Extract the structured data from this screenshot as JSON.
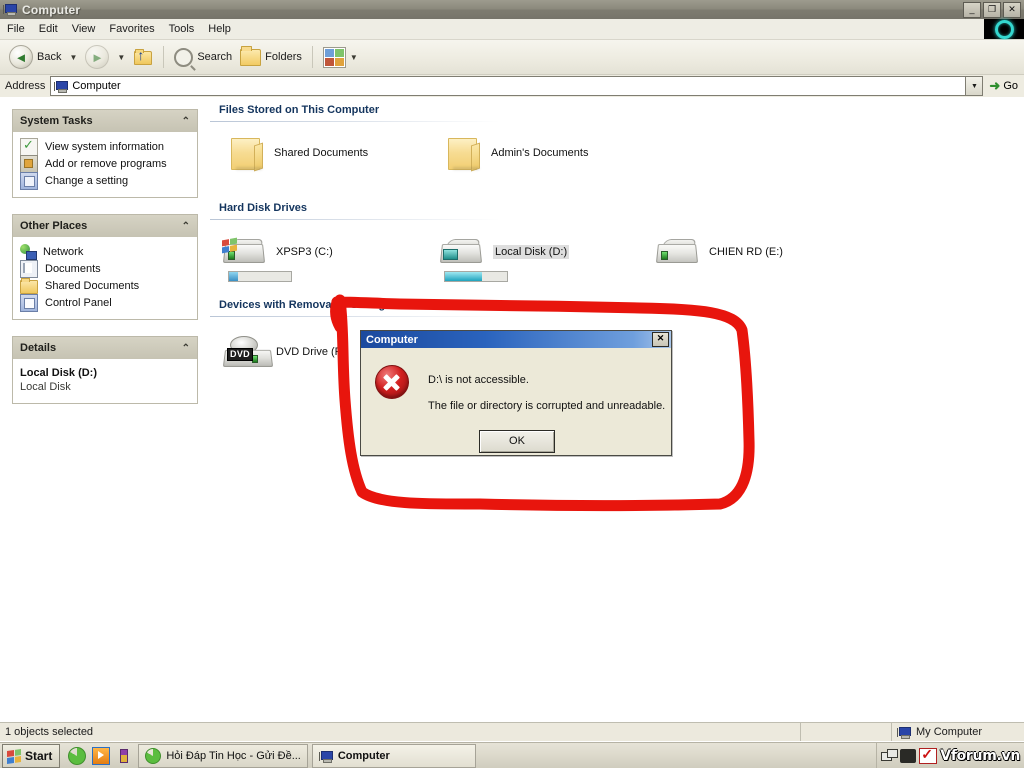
{
  "window": {
    "title": "Computer",
    "title_icon": "my-computer-icon",
    "buttons": {
      "minimize": "_",
      "maximize": "❐",
      "close": "✕"
    }
  },
  "menu": {
    "items": [
      "File",
      "Edit",
      "View",
      "Favorites",
      "Tools",
      "Help"
    ],
    "logo_icon": "teal-ring-logo"
  },
  "toolbar": {
    "back_label": "Back",
    "back_icon": "back-arrow-icon",
    "forward_icon": "forward-arrow-icon",
    "up_icon": "up-folder-icon",
    "search_label": "Search",
    "search_icon": "magnifier-icon",
    "folders_label": "Folders",
    "folders_icon": "folder-icon",
    "views_icon": "views-grid-icon",
    "caret": "▼"
  },
  "address": {
    "label": "Address",
    "value": "Computer",
    "icon": "my-computer-icon",
    "dropdown_caret": "▼",
    "go_label": "Go",
    "go_icon": "green-arrow-icon"
  },
  "sidebar": {
    "panels": [
      {
        "title": "System Tasks",
        "collapse_icon": "chevron-up-icon",
        "items": [
          {
            "label": "View system information",
            "icon": "system-info-icon"
          },
          {
            "label": "Add or remove programs",
            "icon": "add-remove-programs-icon"
          },
          {
            "label": "Change a setting",
            "icon": "control-panel-icon"
          }
        ]
      },
      {
        "title": "Other Places",
        "collapse_icon": "chevron-up-icon",
        "items": [
          {
            "label": "Network",
            "icon": "network-icon"
          },
          {
            "label": "Documents",
            "icon": "documents-icon"
          },
          {
            "label": "Shared Documents",
            "icon": "folder-icon"
          },
          {
            "label": "Control Panel",
            "icon": "control-panel-icon"
          }
        ]
      }
    ],
    "details": {
      "title": "Details",
      "collapse_icon": "chevron-up-icon",
      "name": "Local Disk (D:)",
      "type": "Local Disk"
    }
  },
  "content": {
    "groups": [
      {
        "heading": "Files Stored on This Computer",
        "items": [
          {
            "label": "Shared Documents",
            "icon": "folder-icon",
            "selected": false
          },
          {
            "label": "Admin's Documents",
            "icon": "folder-icon",
            "selected": false
          }
        ]
      },
      {
        "heading": "Hard Disk Drives",
        "items": [
          {
            "label": "XPSP3 (C:)",
            "icon": "hard-disk-icon",
            "selected": false,
            "usage_percent": 14,
            "bar_color": "#4a9fd4"
          },
          {
            "label": "Local Disk (D:)",
            "icon": "hard-disk-icon",
            "selected": true,
            "usage_percent": 60,
            "bar_color": "#2bb3c8"
          },
          {
            "label": "CHIEN RD (E:)",
            "icon": "hard-disk-icon",
            "selected": false,
            "usage_percent": null,
            "bar_color": null
          }
        ]
      },
      {
        "heading": "Devices with Removable Storage",
        "items": [
          {
            "label": "DVD Drive (F:)",
            "icon": "dvd-drive-icon",
            "selected": false,
            "badge": "DVD"
          }
        ]
      }
    ]
  },
  "dialog": {
    "title": "Computer",
    "close_label": "✕",
    "icon": "error-icon",
    "line1": "D:\\ is not accessible.",
    "line2": "The file or directory is corrupted and unreadable.",
    "ok_label": "OK"
  },
  "annotation": {
    "shape": "hand-drawn-red-oval",
    "color": "#e8150d"
  },
  "statusbar": {
    "left": "1 objects selected",
    "middle": "",
    "right": "My Computer",
    "right_icon": "my-computer-icon"
  },
  "taskbar": {
    "start_label": "Start",
    "start_icon": "windows-flag-icon",
    "quick_launch": [
      {
        "icon": "ccleaner-icon"
      },
      {
        "icon": "media-player-icon"
      },
      {
        "icon": "paint-icon"
      }
    ],
    "buttons": [
      {
        "label": "Hỏi Đáp Tin Học - Gửi Đề...",
        "icon": "ccleaner-icon",
        "active": false
      },
      {
        "label": "Computer",
        "icon": "my-computer-icon",
        "active": true
      }
    ],
    "tray": {
      "icons": [
        "network-icon",
        "camera-icon",
        "checkmark-icon"
      ],
      "watermark": "Vforum.vn"
    }
  },
  "colors": {
    "accent": "#14355e",
    "dialog_title": "#1c4a9e",
    "annotation_red": "#e8150d",
    "window_bg": "#ece9d8"
  }
}
